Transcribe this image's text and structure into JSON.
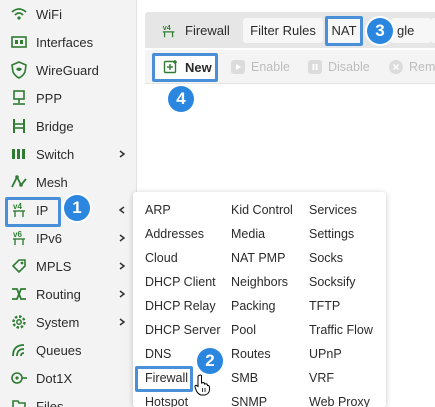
{
  "colors": {
    "accent": "#4a90d9",
    "badge": "#2b86e0",
    "icon_green": "#2e7d32",
    "sidebar_bg": "#f3f3f3"
  },
  "sidebar": {
    "items": [
      {
        "label": "WiFi",
        "icon": "wifi-icon"
      },
      {
        "label": "Interfaces",
        "icon": "interfaces-icon"
      },
      {
        "label": "WireGuard",
        "icon": "wireguard-icon"
      },
      {
        "label": "PPP",
        "icon": "ppp-icon"
      },
      {
        "label": "Bridge",
        "icon": "bridge-icon"
      },
      {
        "label": "Switch",
        "icon": "switch-icon"
      },
      {
        "label": "Mesh",
        "icon": "mesh-icon"
      },
      {
        "label": "IP",
        "icon": "ipv4-icon",
        "icon_text": "v4"
      },
      {
        "label": "IPv6",
        "icon": "ipv6-icon",
        "icon_text": "v6"
      },
      {
        "label": "MPLS",
        "icon": "mpls-icon"
      },
      {
        "label": "Routing",
        "icon": "routing-icon"
      },
      {
        "label": "System",
        "icon": "gear-icon"
      },
      {
        "label": "Queues",
        "icon": "queues-icon"
      },
      {
        "label": "Dot1X",
        "icon": "dot1x-icon"
      },
      {
        "label": "Files",
        "icon": "files-icon"
      }
    ]
  },
  "tabs": {
    "title_icon_text": "v4",
    "title": "Firewall",
    "items": [
      "Filter Rules",
      "NAT",
      "gle"
    ]
  },
  "toolbar": {
    "new_label": "New",
    "enable_label": "Enable",
    "disable_label": "Disable",
    "remove_label": "Rem"
  },
  "ip_menu": {
    "columns": [
      [
        "ARP",
        "Addresses",
        "Cloud",
        "DHCP Client",
        "DHCP Relay",
        "DHCP Server",
        "DNS",
        "Firewall",
        "Hotspot"
      ],
      [
        "Kid Control",
        "Media",
        "NAT PMP",
        "Neighbors",
        "Packing",
        "Pool",
        "Routes",
        "SMB",
        "SNMP"
      ],
      [
        "Services",
        "Settings",
        "Socks",
        "Socksify",
        "TFTP",
        "Traffic Flow",
        "UPnP",
        "VRF",
        "Web Proxy"
      ]
    ]
  },
  "steps": {
    "one": "1",
    "two": "2",
    "three": "3",
    "four": "4"
  }
}
